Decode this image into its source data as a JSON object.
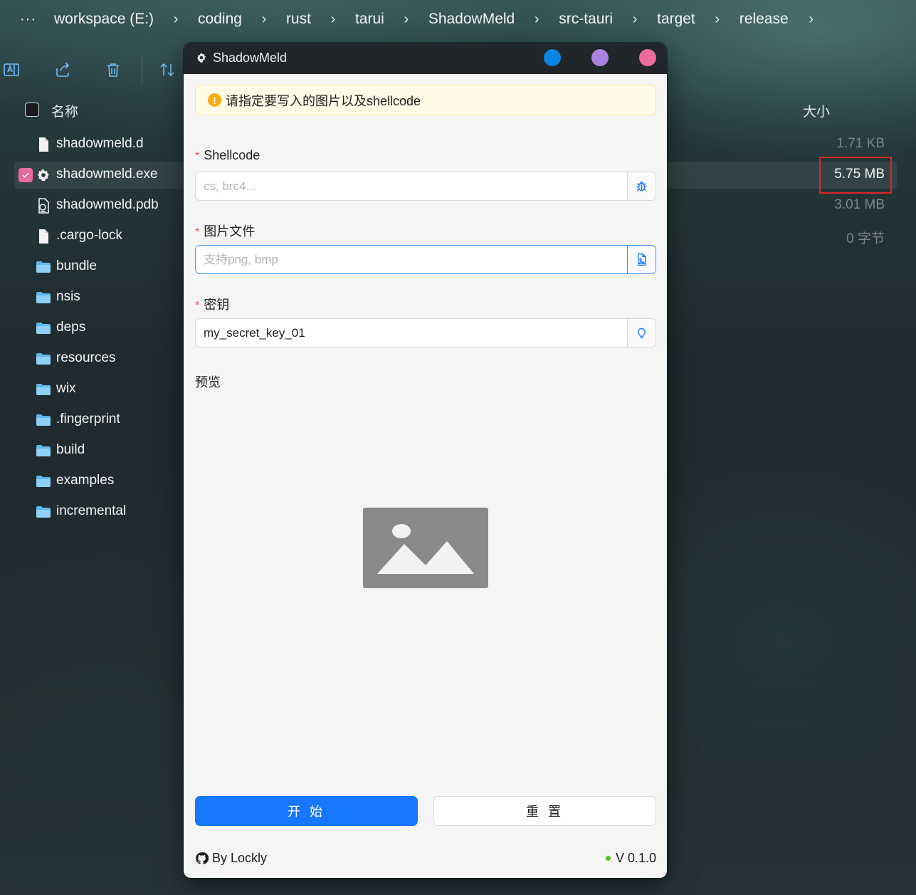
{
  "explorer": {
    "breadcrumb": [
      "workspace (E:)",
      "coding",
      "rust",
      "tarui",
      "ShadowMeld",
      "src-tauri",
      "target",
      "release"
    ],
    "more_label": "···",
    "columns": {
      "name": "名称",
      "size": "大小"
    },
    "files": [
      {
        "name": "shadowmeld.d",
        "size": "1.71 KB",
        "icon": "file-icon",
        "selected": false
      },
      {
        "name": "shadowmeld.exe",
        "size": "5.75 MB",
        "icon": "app-gear-icon",
        "selected": true
      },
      {
        "name": "shadowmeld.pdb",
        "size": "3.01 MB",
        "icon": "pdb-file-icon",
        "selected": false
      },
      {
        "name": ".cargo-lock",
        "size": "0 字节",
        "icon": "file-icon",
        "selected": false
      },
      {
        "name": "bundle",
        "size": "",
        "icon": "folder-icon",
        "selected": false
      },
      {
        "name": "nsis",
        "size": "",
        "icon": "folder-icon",
        "selected": false
      },
      {
        "name": "deps",
        "size": "",
        "icon": "folder-icon",
        "selected": false
      },
      {
        "name": "resources",
        "size": "",
        "icon": "folder-icon",
        "selected": false
      },
      {
        "name": "wix",
        "size": "",
        "icon": "folder-icon",
        "selected": false
      },
      {
        "name": ".fingerprint",
        "size": "",
        "icon": "folder-icon",
        "selected": false
      },
      {
        "name": "build",
        "size": "",
        "icon": "folder-icon",
        "selected": false
      },
      {
        "name": "examples",
        "size": "",
        "icon": "folder-icon",
        "selected": false
      },
      {
        "name": "incremental",
        "size": "",
        "icon": "folder-icon",
        "selected": false
      }
    ]
  },
  "app": {
    "title": "ShadowMeld",
    "window_dots": [
      "#0a84e0",
      "#a884e0",
      "#ec6d9c"
    ],
    "alert": "请指定要写入的图片以及shellcode",
    "fields": {
      "shellcode": {
        "label": "Shellcode",
        "placeholder": "cs, brc4...",
        "value": "",
        "addon_icon": "bug-icon"
      },
      "image": {
        "label": "图片文件",
        "placeholder": "支持png, bmp",
        "value": "",
        "addon_icon": "image-file-icon"
      },
      "key": {
        "label": "密钥",
        "placeholder": "",
        "value": "my_secret_key_01",
        "addon_icon": "bulb-icon"
      }
    },
    "preview_label": "预览",
    "buttons": {
      "start": "开 始",
      "reset": "重 置"
    },
    "footer": {
      "author": "By Lockly",
      "version": "V 0.1.0"
    },
    "colors": {
      "primary": "#1677ff",
      "required": "#ff4d4f",
      "status": "#52c41a",
      "warning": "#faad14"
    }
  }
}
